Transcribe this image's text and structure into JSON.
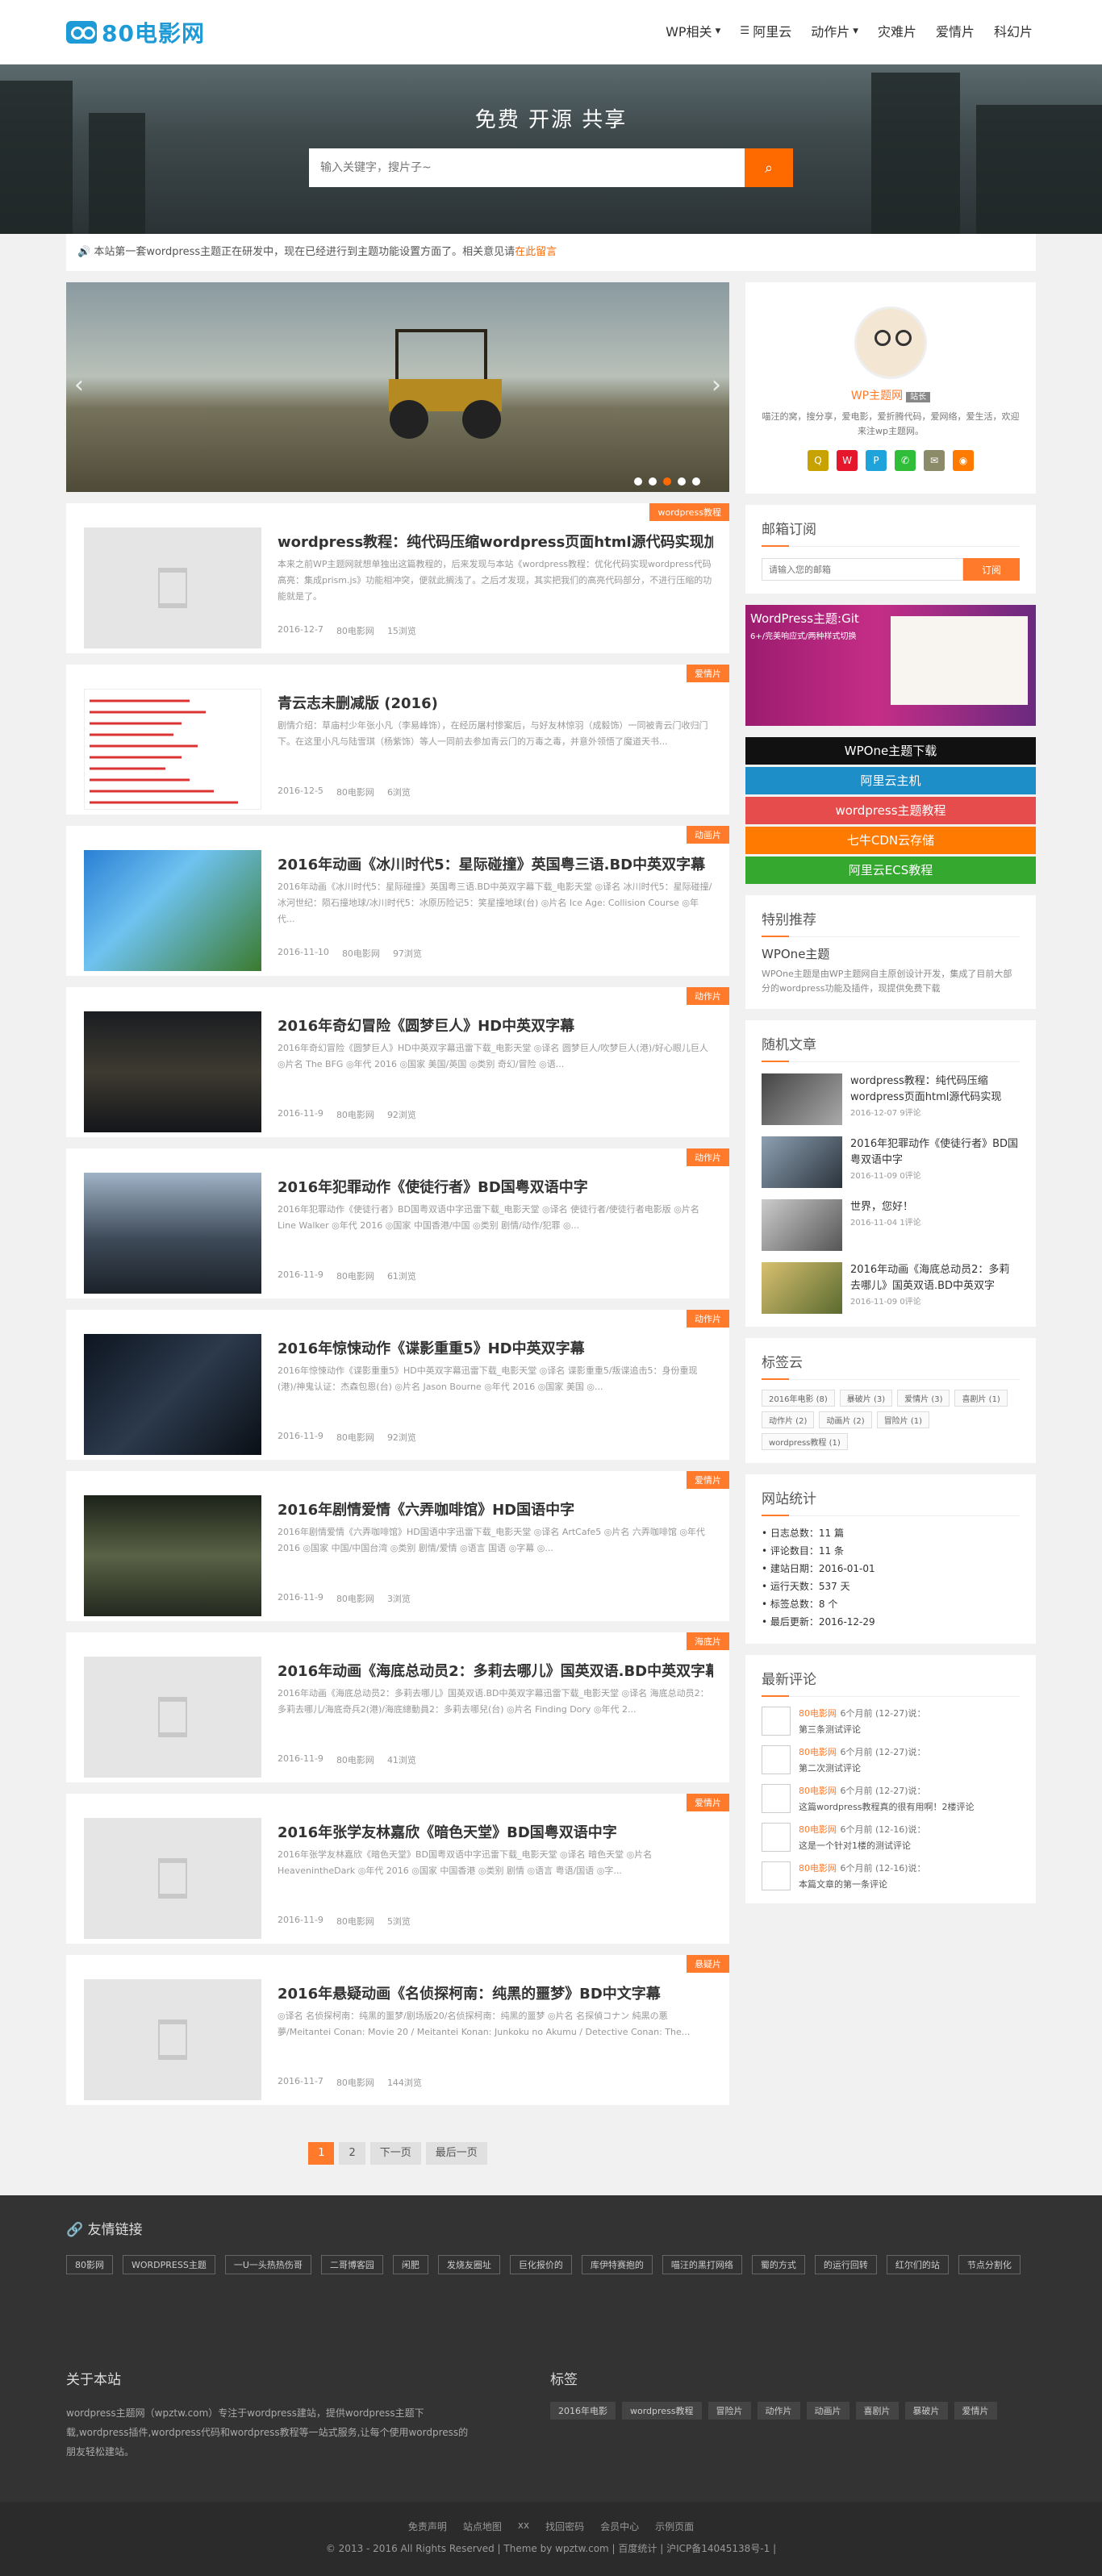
{
  "header": {
    "logo_text": "80电影网",
    "nav": [
      "WP相关",
      "阿里云",
      "动作片",
      "灾难片",
      "爱情片",
      "科幻片"
    ]
  },
  "hero": {
    "title": "免费 开源 共享",
    "search_placeholder": "输入关键字，搜片子~",
    "search_icon": "search-icon"
  },
  "notice": {
    "text": "本站第一套wordpress主题正在研发中，现在已经进行到主题功能设置方面了。相关意见请",
    "link": "在此留言"
  },
  "posts": [
    {
      "tag": "wordpress教程",
      "title": "wordpress教程：纯代码压缩wordpress页面html源代码实现加速",
      "excerpt": "本来之前WP主题网就想单独出这篇教程的，后来发现与本站《wordpress教程：优化代码实现wordpress代码高亮：集成prism.js》功能相冲突，便就此搁浅了。之后才发现，其实把我们的高亮代码部分，不进行压缩的功能就是了。",
      "date": "2016-12-7",
      "author": "80电影网",
      "views": "15浏览"
    },
    {
      "tag": "爱情片",
      "title": "青云志未删减版 (2016)",
      "excerpt": "剧情介绍：草庙村少年张小凡（李易峰饰），在经历屠村惨案后，与好友林惊羽（成毅饰）一同被青云门收归门下。在这里小凡与陆雪琪（杨紫饰）等人一同前去参加青云门的万毒之毒，并意外领悟了魔道天书...",
      "date": "2016-12-5",
      "author": "80电影网",
      "views": "6浏览"
    },
    {
      "tag": "动画片",
      "title": "2016年动画《冰川时代5：星际碰撞》英国粤三语.BD中英双字幕",
      "excerpt": "2016年动画《冰川时代5：星际碰撞》英国粤三语.BD中英双字幕下载_电影天堂 ◎译名 冰川时代5：星际碰撞/冰河世纪：陨石撞地球/冰川时代5：冰原历险记5：笑星撞地球(台) ◎片名 Ice Age: Collision Course ◎年代...",
      "date": "2016-11-10",
      "author": "80电影网",
      "views": "97浏览"
    },
    {
      "tag": "动作片",
      "title": "2016年奇幻冒险《圆梦巨人》HD中英双字幕",
      "excerpt": "2016年奇幻冒险《圆梦巨人》HD中英双字幕迅雷下载_电影天堂 ◎译名 圆梦巨人/吹梦巨人(港)/好心眼儿巨人 ◎片名 The BFG ◎年代 2016 ◎国家 美国/英国 ◎类别 奇幻/冒险 ◎语...",
      "date": "2016-11-9",
      "author": "80电影网",
      "views": "92浏览"
    },
    {
      "tag": "动作片",
      "title": "2016年犯罪动作《使徒行者》BD国粤双语中字",
      "excerpt": "2016年犯罪动作《使徒行者》BD国粤双语中字迅雷下载_电影天堂 ◎译名 使徒行者/使徒行者电影版 ◎片名 Line Walker ◎年代 2016 ◎国家 中国香港/中国 ◎类别 剧情/动作/犯罪 ◎...",
      "date": "2016-11-9",
      "author": "80电影网",
      "views": "61浏览"
    },
    {
      "tag": "动作片",
      "title": "2016年惊悚动作《谍影重重5》HD中英双字幕",
      "excerpt": "2016年惊悚动作《谍影重重5》HD中英双字幕迅雷下载_电影天堂 ◎译名 谍影重重5/叛谍追击5：身份重现(港)/神鬼认证：杰森包恩(台) ◎片名 Jason Bourne ◎年代 2016 ◎国家 美国 ◎...",
      "date": "2016-11-9",
      "author": "80电影网",
      "views": "92浏览"
    },
    {
      "tag": "爱情片",
      "title": "2016年剧情爱情《六弄咖啡馆》HD国语中字",
      "excerpt": "2016年剧情爱情《六弄咖啡馆》HD国语中字迅雷下载_电影天堂 ◎译名 ArtCafe5 ◎片名 六弄咖啡馆 ◎年代 2016 ◎国家 中国/中国台湾 ◎类别 剧情/爱情 ◎语言 国语 ◎字幕 ◎...",
      "date": "2016-11-9",
      "author": "80电影网",
      "views": "3浏览"
    },
    {
      "tag": "海底片",
      "title": "2016年动画《海底总动员2：多莉去哪儿》国英双语.BD中英双字幕",
      "excerpt": "2016年动画《海底总动员2：多莉去哪儿》国英双语.BD中英双字幕迅雷下载_电影天堂 ◎译名 海底总动员2：多莉去哪儿/海底奇兵2(港)/海底總動員2：多莉去哪兒(台) ◎片名 Finding Dory ◎年代 2...",
      "date": "2016-11-9",
      "author": "80电影网",
      "views": "41浏览"
    },
    {
      "tag": "爱情片",
      "title": "2016年张学友林嘉欣《暗色天堂》BD国粤双语中字",
      "excerpt": "2016年张学友林嘉欣《暗色天堂》BD国粤双语中字迅雷下载_电影天堂 ◎译名 暗色天堂 ◎片名 HeavenintheDark ◎年代 2016 ◎国家 中国香港 ◎类别 剧情 ◎语言 粤语/国语 ◎字...",
      "date": "2016-11-9",
      "author": "80电影网",
      "views": "5浏览"
    },
    {
      "tag": "悬疑片",
      "title": "2016年悬疑动画《名侦探柯南：纯黑的噩梦》BD中文字幕",
      "excerpt": "◎译名 名侦探柯南：纯黑的噩梦/剧场版20/名侦探柯南：纯黑的噩梦 ◎片名 名探偵コナン 純黒の悪夢/Meitantei Conan: Movie 20 / Meitantei Konan: Junkoku no Akumu / Detective Conan: The...",
      "date": "2016-11-7",
      "author": "80电影网",
      "views": "144浏览"
    }
  ],
  "pager": [
    "1",
    "2",
    "下一页",
    "最后一页"
  ],
  "profile": {
    "name": "WP主题网",
    "badge": "站长",
    "desc": "喵汪的窝，搜分享，爱电影，爱折腾代码，爱网络，爱生活，欢迎来注wp主题网。"
  },
  "subscribe": {
    "title": "邮箱订阅",
    "placeholder": "请输入您的邮箱",
    "button": "订阅"
  },
  "ad": {
    "title": "WordPress主题:Git",
    "sub": "6+/完美响应式/两种样式切换"
  },
  "buttons": [
    {
      "label": "WPOne主题下载",
      "color": "#111111"
    },
    {
      "label": "阿里云主机",
      "color": "#1e8ec9"
    },
    {
      "label": "wordpress主题教程",
      "color": "#e74c4c"
    },
    {
      "label": "七牛CDN云存储",
      "color": "#ff7a00"
    },
    {
      "label": "阿里云ECS教程",
      "color": "#34a82f"
    }
  ],
  "featured": {
    "title": "特别推荐",
    "name": "WPOne主题",
    "desc": "WPOne主题是由WP主题网自主原创设计开发，集成了目前大部分的wordpress功能及插件，现提供免费下载"
  },
  "random": {
    "title": "随机文章",
    "items": [
      {
        "title": "wordpress教程：纯代码压缩wordpress页面html源代码实现",
        "date": "2016-12-07",
        "comments": "9评论"
      },
      {
        "title": "2016年犯罪动作《使徒行者》BD国粤双语中字",
        "date": "2016-11-09",
        "comments": "0评论"
      },
      {
        "title": "世界，您好！",
        "date": "2016-11-04",
        "comments": "1评论"
      },
      {
        "title": "2016年动画《海底总动员2：多莉去哪儿》国英双语.BD中英双字",
        "date": "2016-11-09",
        "comments": "0评论"
      }
    ]
  },
  "tagcloud": {
    "title": "标签云",
    "tags": [
      "2016年电影 (8)",
      "暴破片 (3)",
      "爱情片 (3)",
      "喜剧片 (1)",
      "动作片 (2)",
      "动画片 (2)",
      "冒险片 (1)",
      "wordpress教程 (1)"
    ]
  },
  "stats": {
    "title": "网站统计",
    "items": [
      "日志总数：11 篇",
      "评论数目：11 条",
      "建站日期：2016-01-01",
      "运行天数：537 天",
      "标签总数：8 个",
      "最后更新：2016-12-29"
    ]
  },
  "comments": {
    "title": "最新评论",
    "items": [
      {
        "name": "80电影网",
        "time": "6个月前 (12-27)说：",
        "text": "第三条测试评论"
      },
      {
        "name": "80电影网",
        "time": "6个月前 (12-27)说：",
        "text": "第二次测试评论"
      },
      {
        "name": "80电影网",
        "time": "6个月前 (12-27)说：",
        "text": "这篇wordpress教程真的很有用啊！2楼评论"
      },
      {
        "name": "80电影网",
        "time": "6个月前 (12-16)说：",
        "text": "这是一个针对1楼的测试评论"
      },
      {
        "name": "80电影网",
        "time": "6个月前 (12-16)说：",
        "text": "本篇文章的第一条评论"
      }
    ]
  },
  "footer": {
    "friends_title": "友情链接",
    "friends": [
      "80影网",
      "WORDPRESS主题",
      "一U一头热热伤哥",
      "二哥博客园",
      "闲肥",
      "发烧友圈址",
      "巨化报价的",
      "库伊特赛抱的",
      "喵汪的黑打网络",
      "蜀的方式",
      "的运行回转",
      "红尔们的站",
      "节点分割化"
    ],
    "about_title": "关于本站",
    "about_text": "wordpress主题网（wpztw.com）专注于wordpress建站，提供wordpress主题下载,wordpress插件,wordpress代码和wordpress教程等一站式服务,让每个使用wordpress的朋友轻松建站。",
    "tags_title": "标签",
    "tags": [
      "2016年电影",
      "wordpress教程",
      "冒险片",
      "动作片",
      "动画片",
      "喜剧片",
      "暴破片",
      "爱情片"
    ],
    "links": [
      "免责声明",
      "站点地图",
      "xx",
      "找回密码",
      "会员中心",
      "示例页面"
    ],
    "copyright": "© 2013 - 2016 All Rights Reserved | Theme by wpztw.com | 百度统计 | 沪ICP备14045138号-1 |"
  }
}
